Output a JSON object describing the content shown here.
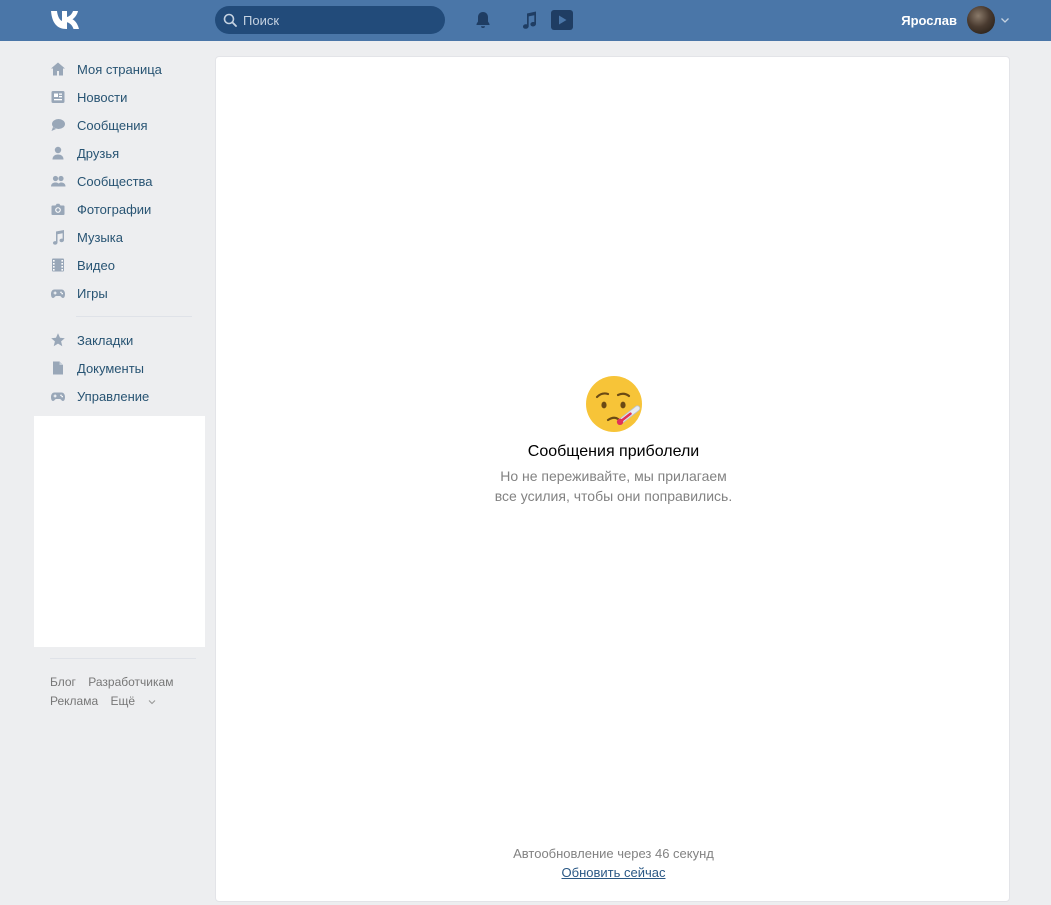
{
  "header": {
    "search_placeholder": "Поиск",
    "user_name": "Ярослав",
    "icons": [
      "vk-logo-icon",
      "search-icon",
      "bell-icon",
      "music-icon",
      "video-icon",
      "chevron-down-icon"
    ]
  },
  "sidebar": {
    "items": [
      {
        "label": "Моя страница",
        "icon": "home-icon"
      },
      {
        "label": "Новости",
        "icon": "news-icon"
      },
      {
        "label": "Сообщения",
        "icon": "messages-icon"
      },
      {
        "label": "Друзья",
        "icon": "friend-icon"
      },
      {
        "label": "Сообщества",
        "icon": "groups-icon"
      },
      {
        "label": "Фотографии",
        "icon": "camera-icon"
      },
      {
        "label": "Музыка",
        "icon": "music-icon"
      },
      {
        "label": "Видео",
        "icon": "film-icon"
      },
      {
        "label": "Игры",
        "icon": "gamepad-icon"
      }
    ],
    "items2": [
      {
        "label": "Закладки",
        "icon": "star-icon"
      },
      {
        "label": "Документы",
        "icon": "document-icon"
      },
      {
        "label": "Управление",
        "icon": "gamepad-icon"
      }
    ],
    "footer": {
      "blog": "Блог",
      "developers": "Разработчикам",
      "ads": "Реклама",
      "more": "Ещё"
    }
  },
  "main": {
    "title": "Сообщения приболели",
    "text_line1": "Но не переживайте, мы прилагаем",
    "text_line2": "все усилия, чтобы они поправились.",
    "auto_refresh": "Автообновление через 46 секунд",
    "refresh_link": "Обновить сейчас"
  },
  "colors": {
    "header_bg": "#4a76a8",
    "page_bg": "#edeef0",
    "link": "#285473",
    "muted": "#828282"
  }
}
